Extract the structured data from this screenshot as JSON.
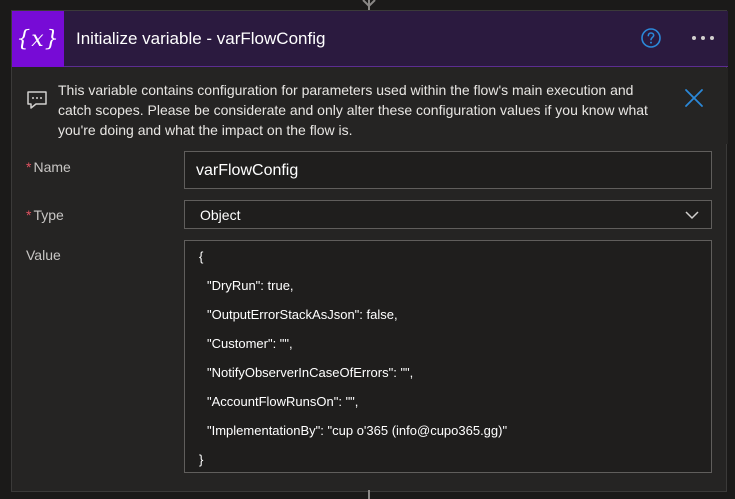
{
  "header": {
    "icon_text": "{x}",
    "title": "Initialize variable - varFlowConfig"
  },
  "info": {
    "text": "This variable contains configuration for parameters used within the flow's main execution and catch scopes. Please be considerate and only alter these configuration values if you know what you're doing and what the impact on the flow is."
  },
  "fields": {
    "name_label": "Name",
    "name_value": "varFlowConfig",
    "type_label": "Type",
    "type_value": "Object",
    "value_label": "Value",
    "required_marker": "*"
  },
  "value_lines": [
    "{",
    "\"DryRun\": true,",
    "\"OutputErrorStackAsJson\": false,",
    "\"Customer\": \"\",",
    "\"NotifyObserverInCaseOfErrors\": \"\",",
    "\"AccountFlowRunsOn\": \"\",",
    "\"ImplementationBy\": \"cup o'365 (info@cupo365.gg)\"",
    "}"
  ],
  "colors": {
    "accent_purple": "#770bd6",
    "header_bg": "#2b1a3f",
    "link_blue": "#2b88d8",
    "required_red": "#e05260"
  },
  "icons": {
    "header": "variable-icon",
    "help": "help-icon",
    "more": "more-options-icon",
    "comment": "comment-icon",
    "close": "close-icon",
    "chevron": "chevron-down-icon"
  }
}
